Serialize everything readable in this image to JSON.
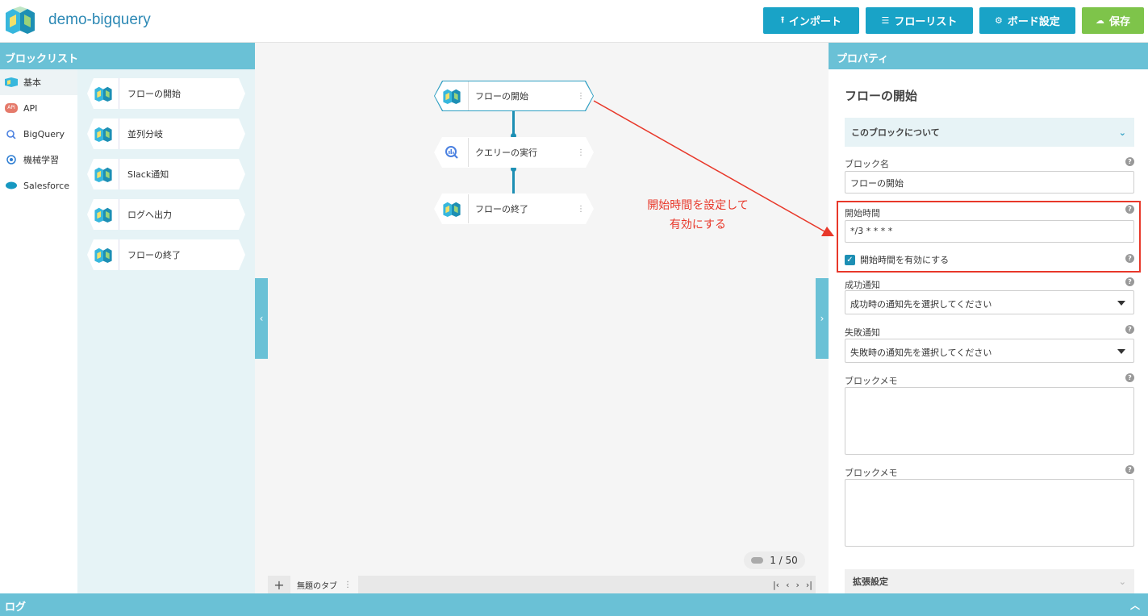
{
  "header": {
    "app_title": "demo-bigquery",
    "buttons": [
      {
        "label": "インポート",
        "icon": "upload-icon",
        "color": "#19a3c7"
      },
      {
        "label": "フローリスト",
        "icon": "list-icon",
        "color": "#19a3c7"
      },
      {
        "label": "ボード設定",
        "icon": "gear-icon",
        "color": "#19a3c7"
      },
      {
        "label": "保存",
        "icon": "cloud-upload-icon",
        "color": "#7ec44a"
      }
    ]
  },
  "block_list": {
    "title": "ブロックリスト",
    "categories": [
      {
        "label": "基本",
        "icon": "flow-icon",
        "active": true
      },
      {
        "label": "API",
        "icon": "api-icon"
      },
      {
        "label": "BigQuery",
        "icon": "bigquery-icon"
      },
      {
        "label": "機械学習",
        "icon": "machine-learning-icon"
      },
      {
        "label": "Salesforce",
        "icon": "salesforce-icon"
      }
    ],
    "blocks": [
      {
        "label": "フローの開始"
      },
      {
        "label": "並列分岐"
      },
      {
        "label": "Slack通知"
      },
      {
        "label": "ログへ出力"
      },
      {
        "label": "フローの終了"
      }
    ]
  },
  "canvas": {
    "nodes": [
      {
        "label": "フローの開始",
        "icon": "flow-icon",
        "selected": true
      },
      {
        "label": "クエリーの実行",
        "icon": "bigquery-icon"
      },
      {
        "label": "フローの終了",
        "icon": "flow-icon"
      }
    ],
    "annotation_line1": "開始時間を設定して",
    "annotation_line2": "有効にする",
    "page_indicator": "1 / 50",
    "tab_label": "無題のタブ",
    "tab_add": "+"
  },
  "properties": {
    "title": "プロパティ",
    "block_title": "フローの開始",
    "about_section": "このブロックについて",
    "block_name_label": "ブロック名",
    "block_name_value": "フローの開始",
    "start_time_label": "開始時間",
    "start_time_value": "*/3 * * * *",
    "enable_start_time_label": "開始時間を有効にする",
    "enable_start_time_checked": true,
    "success_label": "成功通知",
    "success_placeholder": "成功時の通知先を選択してください",
    "failure_label": "失敗通知",
    "failure_placeholder": "失敗時の通知先を選択してください",
    "memo_label_1": "ブロックメモ",
    "memo_label_2": "ブロックメモ",
    "extended_settings": "拡張設定"
  },
  "log": {
    "title": "ログ"
  },
  "colors": {
    "accent": "#6ac1d6",
    "primary_button": "#19a3c7",
    "save_button": "#7ec44a",
    "annotation": "#e8382a"
  }
}
